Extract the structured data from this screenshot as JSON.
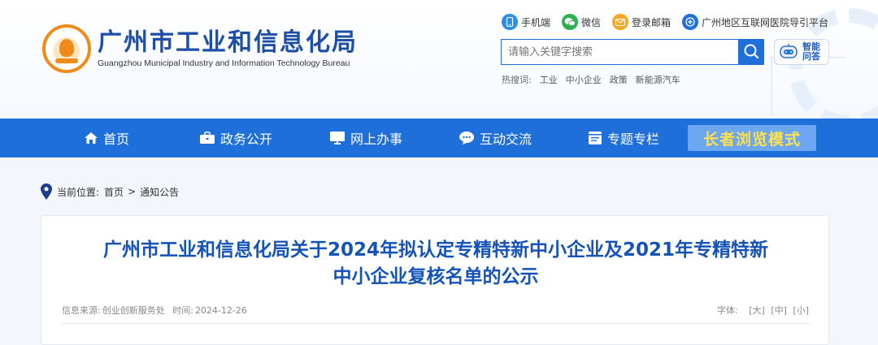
{
  "header": {
    "logo_cn": "广州市工业和信息化局",
    "logo_en": "Guangzhou Municipal Industry and Information Technology Bureau",
    "top_links": [
      {
        "label": "手机端",
        "icon": "mobile-icon",
        "color": "#2b8de8"
      },
      {
        "label": "微信",
        "icon": "wechat-icon",
        "color": "#2bb24c"
      },
      {
        "label": "登录邮箱",
        "icon": "mail-icon",
        "color": "#f5a623"
      },
      {
        "label": "广州地区互联网医院导引平台",
        "icon": "hospital-icon",
        "color": "#1e6fd9"
      }
    ],
    "search_placeholder": "请输入关键字搜索",
    "ai_label": "智能问答",
    "hot_label": "热搜词:",
    "hot_words": [
      "工业",
      "中小企业",
      "政策",
      "新能源汽车"
    ]
  },
  "nav": {
    "items": [
      {
        "label": "首页",
        "icon": "home-icon"
      },
      {
        "label": "政务公开",
        "icon": "briefcase-icon"
      },
      {
        "label": "网上办事",
        "icon": "monitor-icon"
      },
      {
        "label": "互动交流",
        "icon": "chat-icon"
      },
      {
        "label": "专题专栏",
        "icon": "column-icon"
      }
    ],
    "elder_mode": "长者浏览模式",
    "bar_color": "#1e6fd9"
  },
  "breadcrumb": {
    "prefix": "当前位置:",
    "home": "首页",
    "separator": ">",
    "current": "通知公告"
  },
  "article": {
    "title_line1": "广州市工业和信息化局关于2024年拟认定专精特新中小企业及2021年专精特新",
    "title_line2": "中小企业复核名单的公示",
    "source_label": "信息来源:",
    "source": "创业创新服务处",
    "time_label": "时间:",
    "time": "2024-12-26",
    "font_label": "字体:",
    "font_sizes": [
      "[大]",
      "[中]",
      "[小]"
    ]
  }
}
